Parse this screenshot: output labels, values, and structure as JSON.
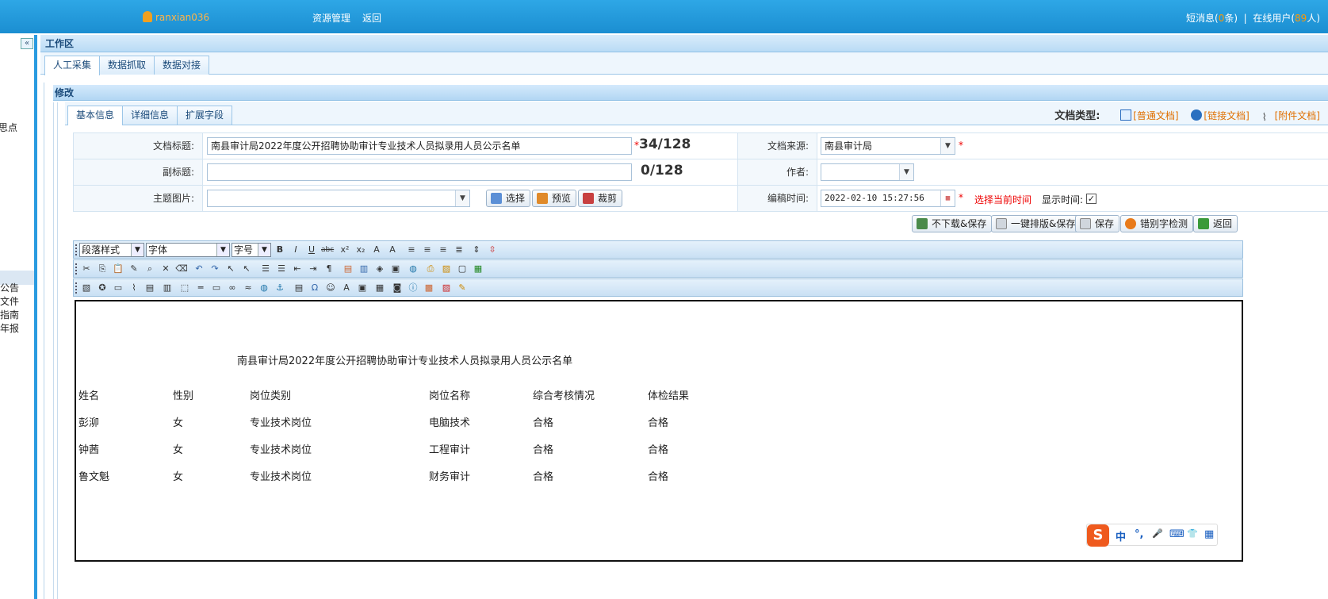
{
  "topbar": {
    "user": "ranxian036",
    "nav": [
      "资源管理",
      "返回"
    ],
    "messages_prefix": "短消息(",
    "messages_count": "0",
    "messages_suffix": "条)",
    "online_prefix": "在线用户(",
    "online_count": "89",
    "online_suffix": "人)"
  },
  "sidebar": {
    "collapse_label": "«",
    "items": [
      "思点",
      "公告",
      "文件",
      "指南",
      "年报"
    ]
  },
  "workspace": {
    "title": "工作区",
    "tabs": [
      "人工采集",
      "数据抓取",
      "数据对接"
    ]
  },
  "modify": {
    "title": "修改",
    "tabs": [
      "基本信息",
      "详细信息",
      "扩展字段"
    ],
    "doctype_label": "文档类型:",
    "doctypes": [
      "[普通文档]",
      "[链接文档]",
      "[附件文档]"
    ]
  },
  "form": {
    "title_label": "文档标题:",
    "title_value": "南县审计局2022年度公开招聘协助审计专业技术人员拟录用人员公示名单",
    "title_count": "34/128",
    "subtitle_label": "副标题:",
    "subtitle_value": "",
    "subtitle_count": "0/128",
    "image_label": "主题图片:",
    "image_value": "",
    "btn_select": "选择",
    "btn_preview": "预览",
    "btn_crop": "裁剪",
    "source_label": "文档来源:",
    "source_value": "南县审计局",
    "author_label": "作者:",
    "author_value": "",
    "time_label": "编稿时间:",
    "time_value": "2022-02-10 15:27:56",
    "select_current_time": "选择当前时间",
    "show_time_label": "显示时间:",
    "show_time_checked": "✓",
    "required_mark": "*"
  },
  "actions": [
    "不下载&保存",
    "一键排版&保存",
    "保存",
    "错别字检测",
    "返回"
  ],
  "toolbar": {
    "paragraph_style": "段落样式",
    "font": "字体",
    "font_size": "字号"
  },
  "editor": {
    "doc_title": "南县审计局2022年度公开招聘协助审计专业技术人员拟录用人员公示名单",
    "headers": [
      "姓名",
      "性别",
      "岗位类别",
      "岗位名称",
      "综合考核情况",
      "体检结果"
    ],
    "rows": [
      [
        "彭泖",
        "女",
        "专业技术岗位",
        "电脑技术",
        "合格",
        "合格"
      ],
      [
        "钟茜",
        "女",
        "专业技术岗位",
        "工程审计",
        "合格",
        "合格"
      ],
      [
        "鲁文魁",
        "女",
        "专业技术岗位",
        "财务审计",
        "合格",
        "合格"
      ]
    ]
  },
  "ime": {
    "logo": "S",
    "keys": [
      "中",
      "°,",
      "🎤",
      "⌨",
      "👕",
      "▦"
    ]
  }
}
